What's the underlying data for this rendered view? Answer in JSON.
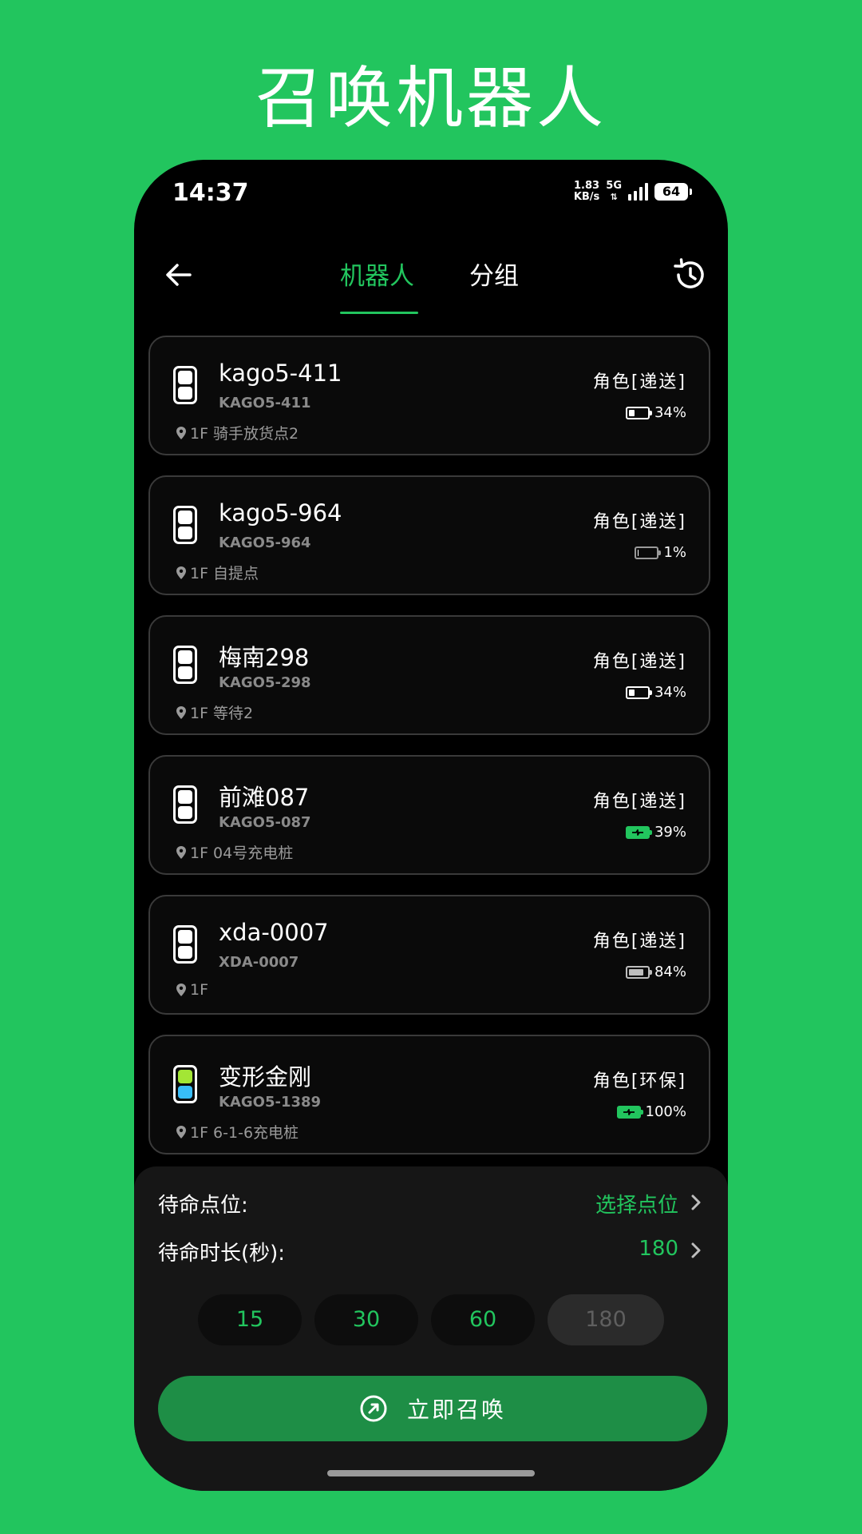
{
  "banner": {
    "title": "召唤机器人"
  },
  "status_bar": {
    "time": "14:37",
    "net_speed_value": "1.83",
    "net_speed_unit": "KB/s",
    "network": "5G",
    "battery": "64"
  },
  "header": {
    "tabs": [
      {
        "label": "机器人",
        "active": true
      },
      {
        "label": "分组",
        "active": false
      }
    ]
  },
  "robots": [
    {
      "name": "kago5-411",
      "code": "KAGO5-411",
      "location": "1F 骑手放货点2",
      "role": "角色[递送]",
      "battery": "34%",
      "battery_level": 0.34,
      "charging": false,
      "icon": "robot-icon"
    },
    {
      "name": "kago5-964",
      "code": "KAGO5-964",
      "location": "1F 自提点",
      "role": "角色[递送]",
      "battery": "1%",
      "battery_level": 0.01,
      "charging": false,
      "icon": "robot-icon"
    },
    {
      "name": "梅南298",
      "code": "KAGO5-298",
      "location": "1F 等待2",
      "role": "角色[递送]",
      "battery": "34%",
      "battery_level": 0.34,
      "charging": false,
      "icon": "robot-icon"
    },
    {
      "name": "前滩087",
      "code": "KAGO5-087",
      "location": "1F 04号充电桩",
      "role": "角色[递送]",
      "battery": "39%",
      "battery_level": 0.39,
      "charging": true,
      "icon": "robot-icon"
    },
    {
      "name": "xda-0007",
      "code": "XDA-0007",
      "location": "1F",
      "role": "角色[递送]",
      "battery": "84%",
      "battery_level": 0.84,
      "charging": false,
      "icon": "robot-icon"
    },
    {
      "name": "变形金刚",
      "code": "KAGO5-1389",
      "location": "1F 6-1-6充电桩",
      "role": "角色[环保]",
      "battery": "100%",
      "battery_level": 1.0,
      "charging": true,
      "icon": "robot-color-icon"
    }
  ],
  "settings": {
    "standby_point_label": "待命点位:",
    "standby_point_value": "选择点位",
    "standby_duration_label": "待命时长(秒):",
    "standby_duration_value": "180",
    "duration_options": [
      "15",
      "30",
      "60",
      "180"
    ],
    "selected_duration": "180"
  },
  "summon_button": {
    "label": "立即召唤"
  },
  "colors": {
    "accent": "#22c55e",
    "background": "#000000",
    "card_border": "#3a3a3a",
    "button": "#1e8e46"
  }
}
